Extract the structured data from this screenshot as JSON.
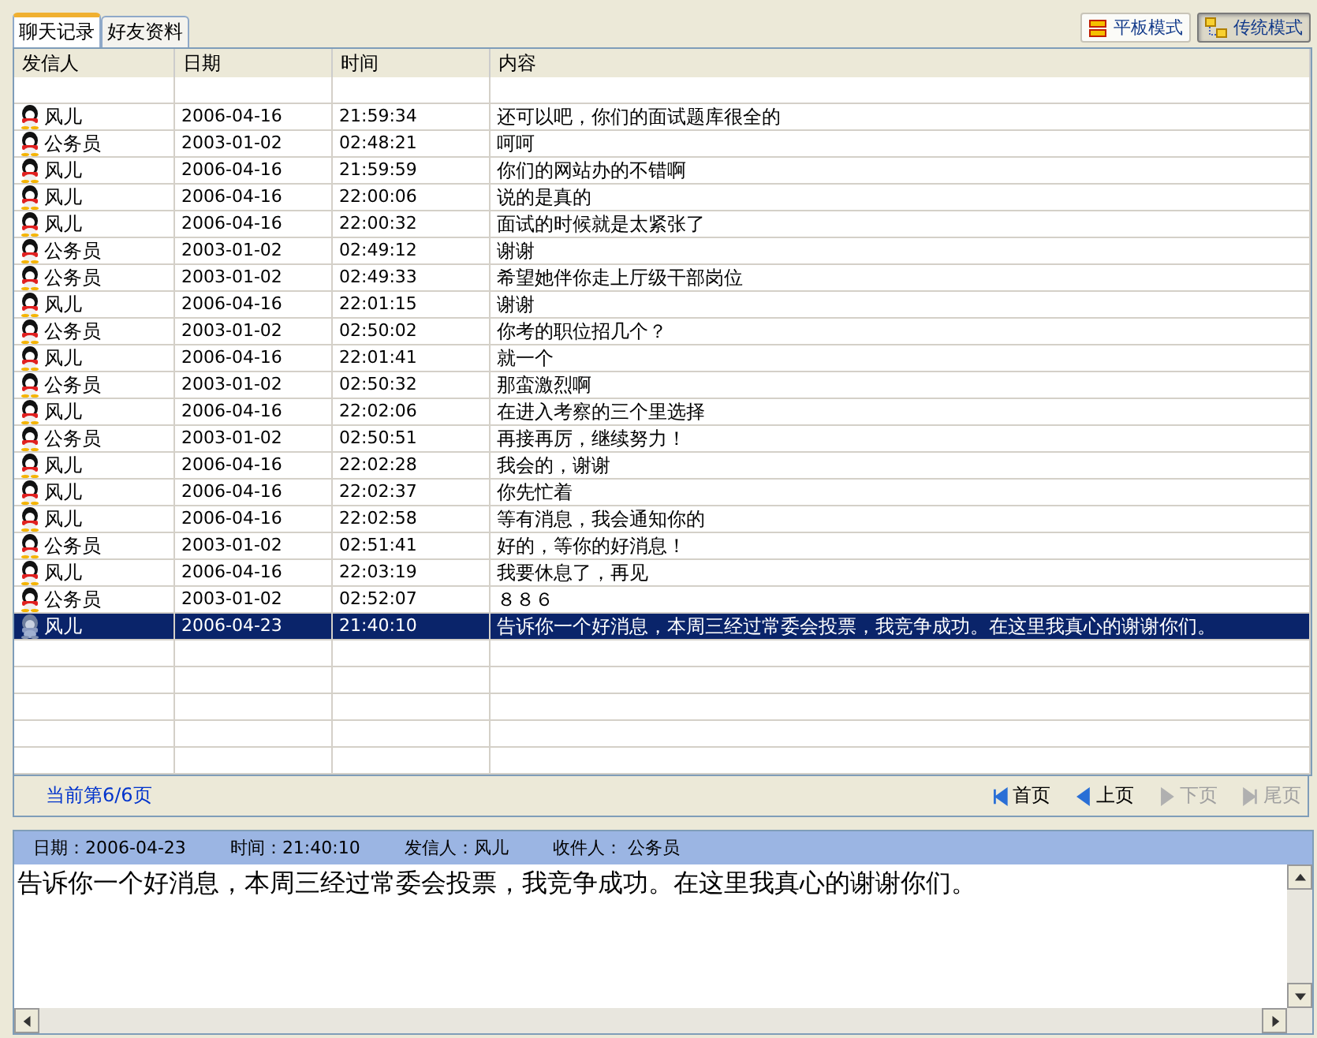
{
  "tabs": [
    {
      "label": "聊天记录",
      "selected": true
    },
    {
      "label": "好友资料",
      "selected": false
    }
  ],
  "modes": [
    {
      "label": "平板模式",
      "kind": "flat",
      "selected": false
    },
    {
      "label": "传统模式",
      "kind": "tree",
      "selected": true
    }
  ],
  "table": {
    "columns": [
      "发信人",
      "日期",
      "时间",
      "内容"
    ],
    "rows": [
      {
        "sender": "风儿",
        "date": "2006-04-16",
        "time": "21:59:34",
        "content": "还可以吧，你们的面试题库很全的",
        "selected": false
      },
      {
        "sender": "公务员",
        "date": "2003-01-02",
        "time": "02:48:21",
        "content": "呵呵",
        "selected": false
      },
      {
        "sender": "风儿",
        "date": "2006-04-16",
        "time": "21:59:59",
        "content": "你们的网站办的不错啊",
        "selected": false
      },
      {
        "sender": "风儿",
        "date": "2006-04-16",
        "time": "22:00:06",
        "content": "说的是真的",
        "selected": false
      },
      {
        "sender": "风儿",
        "date": "2006-04-16",
        "time": "22:00:32",
        "content": "面试的时候就是太紧张了",
        "selected": false
      },
      {
        "sender": "公务员",
        "date": "2003-01-02",
        "time": "02:49:12",
        "content": "谢谢",
        "selected": false
      },
      {
        "sender": "公务员",
        "date": "2003-01-02",
        "time": "02:49:33",
        "content": "希望她伴你走上厅级干部岗位",
        "selected": false
      },
      {
        "sender": "风儿",
        "date": "2006-04-16",
        "time": "22:01:15",
        "content": "谢谢",
        "selected": false
      },
      {
        "sender": "公务员",
        "date": "2003-01-02",
        "time": "02:50:02",
        "content": "你考的职位招几个？",
        "selected": false
      },
      {
        "sender": "风儿",
        "date": "2006-04-16",
        "time": "22:01:41",
        "content": "就一个",
        "selected": false
      },
      {
        "sender": "公务员",
        "date": "2003-01-02",
        "time": "02:50:32",
        "content": "那蛮激烈啊",
        "selected": false
      },
      {
        "sender": "风儿",
        "date": "2006-04-16",
        "time": "22:02:06",
        "content": "在进入考察的三个里选择",
        "selected": false
      },
      {
        "sender": "公务员",
        "date": "2003-01-02",
        "time": "02:50:51",
        "content": "再接再厉，继续努力！",
        "selected": false
      },
      {
        "sender": "风儿",
        "date": "2006-04-16",
        "time": "22:02:28",
        "content": "我会的，谢谢",
        "selected": false
      },
      {
        "sender": "风儿",
        "date": "2006-04-16",
        "time": "22:02:37",
        "content": "你先忙着",
        "selected": false
      },
      {
        "sender": "风儿",
        "date": "2006-04-16",
        "time": "22:02:58",
        "content": "等有消息，我会通知你的",
        "selected": false
      },
      {
        "sender": "公务员",
        "date": "2003-01-02",
        "time": "02:51:41",
        "content": "好的，等你的好消息！",
        "selected": false
      },
      {
        "sender": "风儿",
        "date": "2006-04-16",
        "time": "22:03:19",
        "content": "我要休息了，再见",
        "selected": false
      },
      {
        "sender": "公务员",
        "date": "2003-01-02",
        "time": "02:52:07",
        "content": "８８６",
        "selected": false
      },
      {
        "sender": "风儿",
        "date": "2006-04-23",
        "time": "21:40:10",
        "content": "告诉你一个好消息，本周三经过常委会投票，我竞争成功。在这里我真心的谢谢你们。",
        "selected": true
      }
    ]
  },
  "pager": {
    "status": "当前第6/6页",
    "buttons": [
      {
        "label": "首页",
        "kind": "first",
        "disabled": false
      },
      {
        "label": "上页",
        "kind": "prev",
        "disabled": false
      },
      {
        "label": "下页",
        "kind": "next",
        "disabled": true
      },
      {
        "label": "尾页",
        "kind": "last",
        "disabled": true
      }
    ]
  },
  "detail": {
    "fields": [
      "日期：2006-04-23",
      "时间：21:40:10",
      "发信人：风儿",
      "收件人： 公务员"
    ],
    "message": "告诉你一个好消息，本周三经过常委会投票，我竞争成功。在这里我真心的谢谢你们。"
  }
}
